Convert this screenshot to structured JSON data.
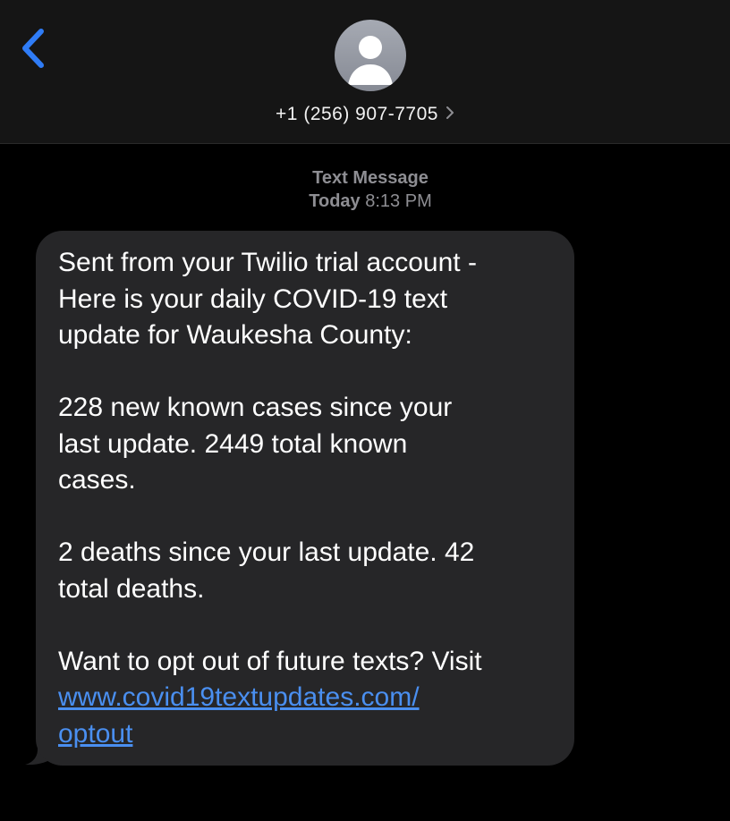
{
  "header": {
    "back_icon": "chevron-left-icon",
    "avatar_icon": "person-silhouette-icon",
    "contact_number": "+1 (256) 907-7705",
    "contact_chevron_icon": "chevron-right-icon",
    "accent_color": "#2f7cf6"
  },
  "meta": {
    "service": "Text Message",
    "day": "Today",
    "time": "8:13 PM"
  },
  "message": {
    "line1": "Sent from your Twilio trial account -",
    "line2": "Here is your daily COVID-19 text",
    "line3": "update for Waukesha County:",
    "cases_1": "228 new known cases since your",
    "cases_2": "last update. 2449 total known",
    "cases_3": "cases.",
    "deaths_1": "2 deaths since your last update. 42",
    "deaths_2": "total deaths.",
    "optout_text": "Want to opt out of future texts? Visit",
    "link_part1": "www.covid19textupdates.com/",
    "link_part2": "optout",
    "bubble_color": "#262628",
    "link_color": "#4a8ff0"
  }
}
